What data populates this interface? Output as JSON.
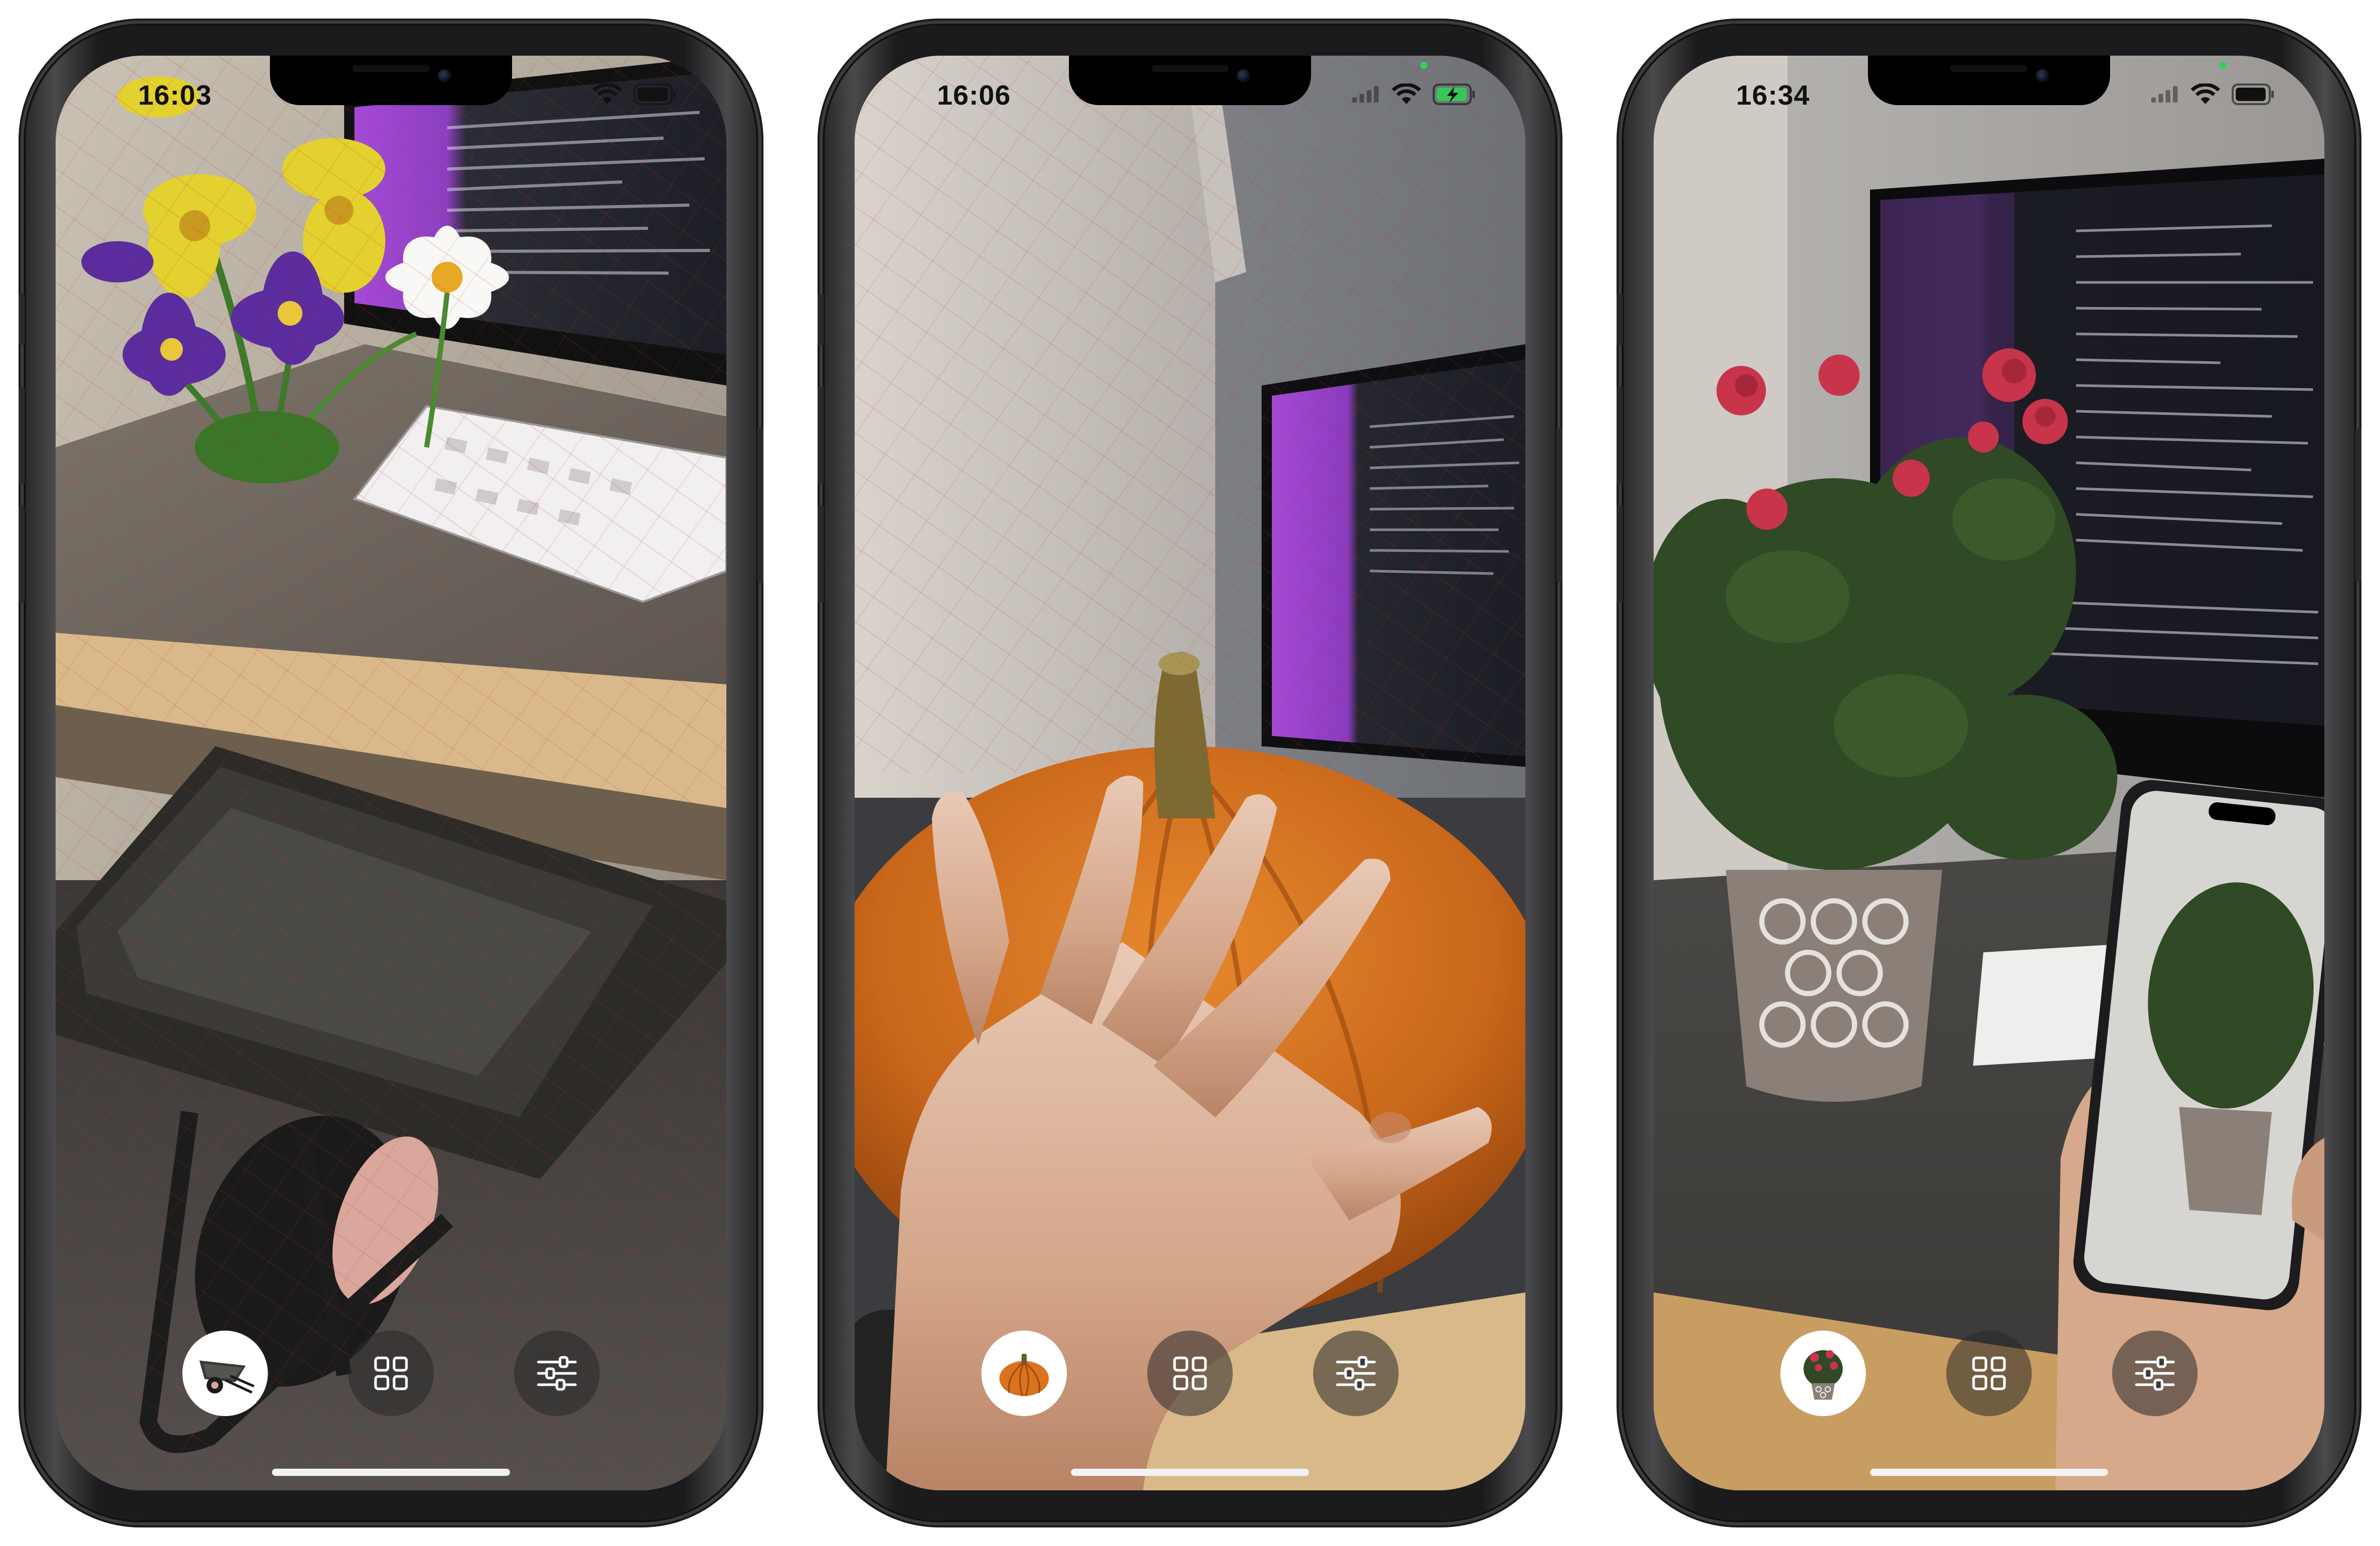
{
  "phones": [
    {
      "time": "16:03",
      "selected_model": "wheelbarrow-icon",
      "scene": "ar-flowers-wheelbarrow",
      "toolbar": {
        "model_button": "wheelbarrow-icon",
        "gallery_button": "grid-icon",
        "settings_button": "sliders-icon"
      }
    },
    {
      "time": "16:06",
      "selected_model": "pumpkin-icon",
      "scene": "ar-pumpkin-hand",
      "battery_color": "#34c759",
      "toolbar": {
        "model_button": "pumpkin-icon",
        "gallery_button": "grid-icon",
        "settings_button": "sliders-icon"
      }
    },
    {
      "time": "16:34",
      "selected_model": "potted-rose-icon",
      "scene": "ar-rose-plant",
      "toolbar": {
        "model_button": "potted-rose-icon",
        "gallery_button": "grid-icon",
        "settings_button": "sliders-icon"
      }
    }
  ],
  "colors": {
    "accent_selected": "#ffffff",
    "toolbar_button_bg": "#3a3a3a",
    "mesh_overlay": "#dc2828",
    "monitor_purple": "#a44ad6",
    "pumpkin_orange": "#d9731e"
  }
}
